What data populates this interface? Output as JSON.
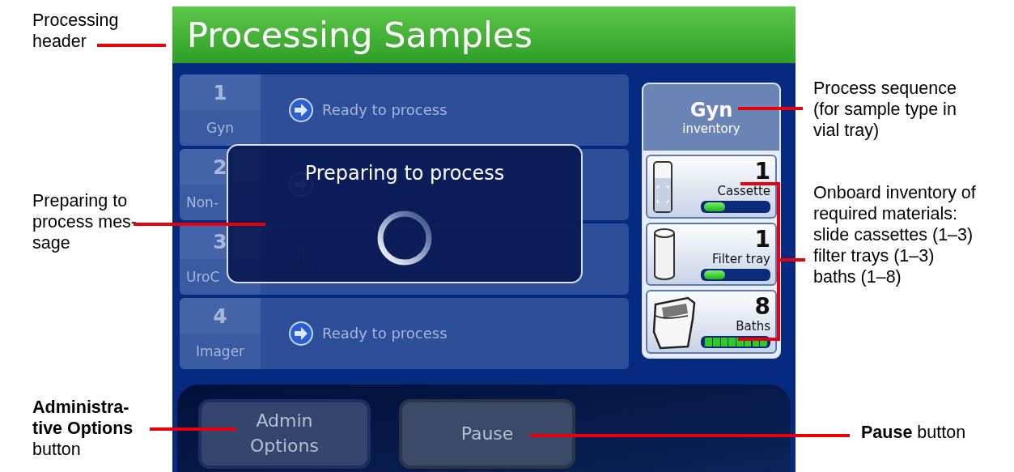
{
  "header": {
    "title": "Processing Samples"
  },
  "rows": [
    {
      "number": "1",
      "type": "Gyn",
      "kind": "ready",
      "status": [
        "Ready to process"
      ]
    },
    {
      "number": "2",
      "type": "Non-",
      "kind": "ready"
    },
    {
      "number": "3",
      "type": "UroC",
      "kind": "warning"
    },
    {
      "number": "4",
      "type": "Imager",
      "kind": "ready",
      "status": [
        "Ready to process"
      ]
    }
  ],
  "dialog": {
    "message": "Preparing to process"
  },
  "inventory": {
    "title": "Gyn",
    "subtitle": "inventory",
    "items": [
      {
        "kind": "cassette",
        "count": "1",
        "label": "Cassette",
        "level": 0.33
      },
      {
        "kind": "filter",
        "count": "1",
        "label": "Filter tray",
        "level": 0.33
      },
      {
        "kind": "bath",
        "count": "8",
        "label": "Baths",
        "level": 1
      }
    ]
  },
  "buttons": [
    {
      "label": [
        "Admin",
        "Options"
      ]
    },
    {
      "label": [
        "Pause"
      ]
    }
  ],
  "callouts": [
    {
      "lines": [
        "Processing",
        "header"
      ]
    },
    {
      "lines": [
        "Preparing to",
        "process mes-",
        "sage"
      ]
    },
    {
      "lines": [
        "**Administra-**",
        "**tive Options**",
        "button"
      ]
    },
    {
      "lines": [
        "Process sequence",
        "(for sample type in",
        "vial tray)"
      ]
    },
    {
      "lines": [
        "Onboard inventory of",
        "required materials:",
        "slide cassettes (1–3)",
        "filter trays (1–3)",
        "baths (1–8)"
      ]
    },
    {
      "lines": [
        "**Pause** button"
      ]
    }
  ]
}
